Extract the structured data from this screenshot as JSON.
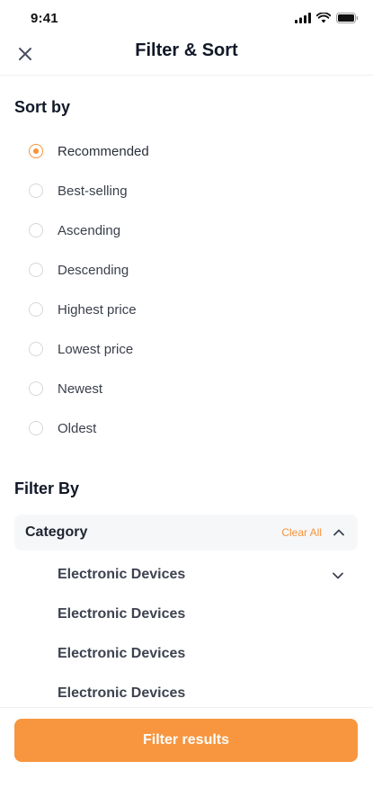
{
  "status_bar": {
    "time": "9:41"
  },
  "header": {
    "title": "Filter & Sort",
    "close_icon": "close-icon"
  },
  "sort": {
    "title": "Sort by",
    "options": [
      {
        "label": "Recommended",
        "selected": true
      },
      {
        "label": "Best-selling",
        "selected": false
      },
      {
        "label": "Ascending",
        "selected": false
      },
      {
        "label": "Descending",
        "selected": false
      },
      {
        "label": "Highest price",
        "selected": false
      },
      {
        "label": "Lowest price",
        "selected": false
      },
      {
        "label": "Newest",
        "selected": false
      },
      {
        "label": "Oldest",
        "selected": false
      }
    ]
  },
  "filter": {
    "title": "Filter By",
    "category": {
      "label": "Category",
      "clear_all": "Clear All",
      "items": [
        {
          "label": "Electronic Devices"
        },
        {
          "label": "Electronic Devices"
        },
        {
          "label": "Electronic Devices"
        },
        {
          "label": "Electronic Devices"
        }
      ]
    }
  },
  "footer": {
    "button_label": "Filter results"
  },
  "colors": {
    "accent": "#f7933a",
    "button": "#f7963f",
    "text": "#1f2430"
  }
}
